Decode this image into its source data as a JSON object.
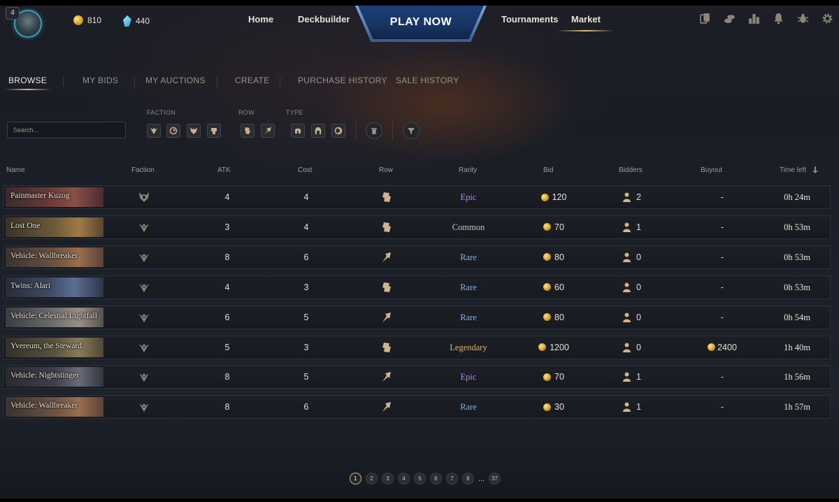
{
  "player": {
    "level": "4"
  },
  "currency": {
    "gold": "810",
    "shards": "440"
  },
  "nav": {
    "home": "Home",
    "deckbuilder": "Deckbuilder",
    "play_now": "PLAY NOW",
    "tournaments": "Tournaments",
    "market": "Market"
  },
  "top_icons": [
    "cards-icon",
    "coins-icon",
    "leaderboard-icon",
    "bell-icon",
    "bug-icon",
    "gear-icon"
  ],
  "subtabs": [
    "BROWSE",
    "MY BIDS",
    "MY AUCTIONS",
    "CREATE",
    "PURCHASE HISTORY",
    "SALE HISTORY"
  ],
  "filters": {
    "search_placeholder": "Search...",
    "faction_label": "FACTION",
    "row_label": "ROW",
    "type_label": "TYPE"
  },
  "table": {
    "headers": {
      "name": "Name",
      "faction": "Faction",
      "atk": "ATK",
      "cost": "Cost",
      "row": "Row",
      "rarity": "Rarity",
      "bid": "Bid",
      "bidders": "Bidders",
      "buyout": "Buyout",
      "time_left": "Time left"
    },
    "rows": [
      {
        "name": "Painmaster Kuzog",
        "faction": "monster",
        "atk": "4",
        "cost": "4",
        "row": "melee",
        "rarity": "Epic",
        "bid": "120",
        "bidders": "2",
        "buyout": "-",
        "time_left": "0h 24m"
      },
      {
        "name": "Lost One",
        "faction": "empire",
        "atk": "3",
        "cost": "4",
        "row": "melee",
        "rarity": "Common",
        "bid": "70",
        "bidders": "1",
        "buyout": "-",
        "time_left": "0h 53m"
      },
      {
        "name": "Vehicle: Wallbreaker",
        "faction": "empire",
        "atk": "8",
        "cost": "6",
        "row": "ranged",
        "rarity": "Rare",
        "bid": "80",
        "bidders": "0",
        "buyout": "-",
        "time_left": "0h 53m"
      },
      {
        "name": "Twins: Alari",
        "faction": "empire",
        "atk": "4",
        "cost": "3",
        "row": "melee",
        "rarity": "Rare",
        "bid": "60",
        "bidders": "0",
        "buyout": "-",
        "time_left": "0h 53m"
      },
      {
        "name": "Vehicle: Celestial Lightfall",
        "faction": "empire",
        "atk": "6",
        "cost": "5",
        "row": "ranged",
        "rarity": "Rare",
        "bid": "80",
        "bidders": "0",
        "buyout": "-",
        "time_left": "0h 54m"
      },
      {
        "name": "Yvereum, the Steward",
        "faction": "empire",
        "atk": "5",
        "cost": "3",
        "row": "melee",
        "rarity": "Legendary",
        "bid": "1200",
        "bidders": "0",
        "buyout": "2400",
        "time_left": "1h 40m"
      },
      {
        "name": "Vehicle: Nightstinger",
        "faction": "empire",
        "atk": "8",
        "cost": "5",
        "row": "ranged",
        "rarity": "Epic",
        "bid": "70",
        "bidders": "1",
        "buyout": "-",
        "time_left": "1h 56m"
      },
      {
        "name": "Vehicle: Wallbreaker",
        "faction": "empire",
        "atk": "8",
        "cost": "6",
        "row": "ranged",
        "rarity": "Rare",
        "bid": "30",
        "bidders": "1",
        "buyout": "-",
        "time_left": "1h 57m"
      }
    ]
  },
  "rarity_colors": {
    "Common": "#cdc8be",
    "Rare": "#7fb3e0",
    "Epic": "#b78be6",
    "Legendary": "#e6b25a"
  },
  "pagination": {
    "pages": [
      "1",
      "2",
      "3",
      "4",
      "5",
      "6",
      "7",
      "8"
    ],
    "ellipsis": "...",
    "last": "37",
    "current": "1"
  }
}
